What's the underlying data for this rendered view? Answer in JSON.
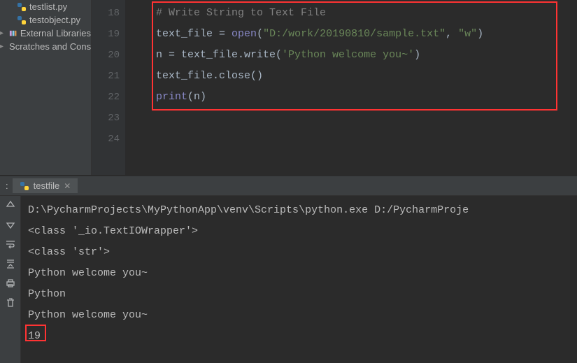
{
  "sidebar": {
    "items": [
      {
        "label": "testlist.py",
        "type": "py",
        "indent": "deep"
      },
      {
        "label": "testobject.py",
        "type": "py",
        "indent": "deep"
      },
      {
        "label": "External Libraries",
        "type": "lib",
        "indent": "root"
      },
      {
        "label": "Scratches and Consoles",
        "type": "scr",
        "indent": "root"
      }
    ]
  },
  "editor": {
    "gutter": [
      "18",
      "19",
      "20",
      "21",
      "22",
      "23",
      "24"
    ],
    "lines": {
      "l18": "# Write String to Text File",
      "l19_a": "text_file = ",
      "l19_b": "open",
      "l19_c": "(",
      "l19_d": "\"D:/work/20190810/sample.txt\"",
      "l19_e": ", ",
      "l19_f": "\"w\"",
      "l19_g": ")",
      "l20_a": "n = text_file.write(",
      "l20_b": "'Python welcome you~'",
      "l20_c": ")",
      "l21": "text_file.close()",
      "l22_a": "print",
      "l22_b": "(n)"
    }
  },
  "run": {
    "label": ":",
    "tab": "testfile",
    "console": [
      "D:\\PycharmProjects\\MyPythonApp\\venv\\Scripts\\python.exe D:/PycharmProje",
      "<class '_io.TextIOWrapper'>",
      "<class 'str'>",
      "Python welcome you~",
      "Python",
      "Python welcome you~",
      "19"
    ]
  }
}
